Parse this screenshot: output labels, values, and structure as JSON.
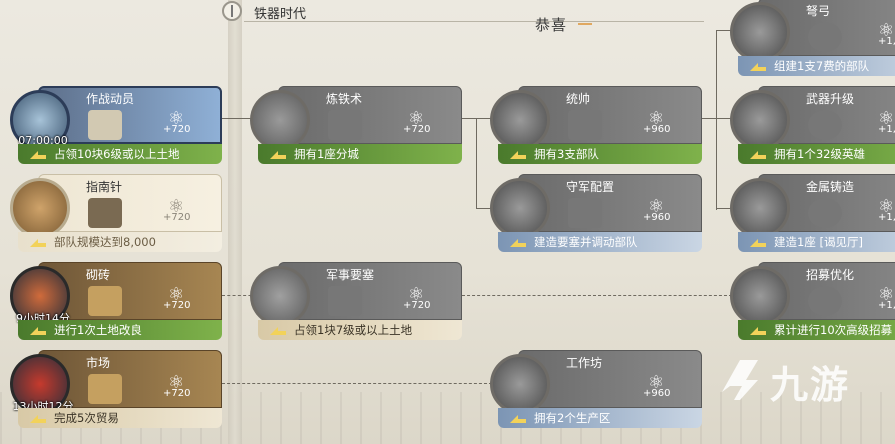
{
  "era": {
    "label": "铁器时代"
  },
  "banner": {
    "congrats": "恭喜"
  },
  "cards": {
    "combat_mobilization": {
      "title": "作战动员",
      "timer": "07:00:00",
      "value": "+720",
      "requirement": "占领10块6级或以上土地"
    },
    "compass": {
      "title": "指南针",
      "value": "+720",
      "requirement": "部队规模达到8,000"
    },
    "brick": {
      "title": "砌砖",
      "timer": "9小时14分",
      "value": "+720",
      "requirement": "进行1次土地改良"
    },
    "market": {
      "title": "市场",
      "timer": "13小时12分",
      "value": "+720",
      "requirement": "完成5次贸易"
    },
    "iron_smelting": {
      "title": "炼铁术",
      "value": "+720",
      "requirement": "拥有1座分城"
    },
    "fortress": {
      "title": "军事要塞",
      "value": "+720",
      "requirement": "占领1块7级或以上土地"
    },
    "commander": {
      "title": "统帅",
      "value": "+960",
      "requirement": "拥有3支部队"
    },
    "garrison": {
      "title": "守军配置",
      "value": "+960",
      "requirement": "建造要塞并调动部队"
    },
    "workshop": {
      "title": "工作坊",
      "value": "+960",
      "requirement": "拥有2个生产区"
    },
    "crossbow": {
      "title": "弩弓",
      "value": "+1,",
      "requirement": "组建1支7费的部队"
    },
    "weapon_upgrade": {
      "title": "武器升级",
      "value": "+1,",
      "requirement": "拥有1个32级英雄"
    },
    "metal_casting": {
      "title": "金属铸造",
      "value": "+1,",
      "requirement": "建造1座 [谒见厅]"
    },
    "recruit_opt": {
      "title": "招募优化",
      "value": "+1,",
      "requirement": "累计进行10次高级招募"
    }
  },
  "watermark": {
    "text": "九游"
  },
  "icons": [
    "arrow-icon",
    "atom-icon",
    "resource-icon",
    "watermark-logo"
  ]
}
